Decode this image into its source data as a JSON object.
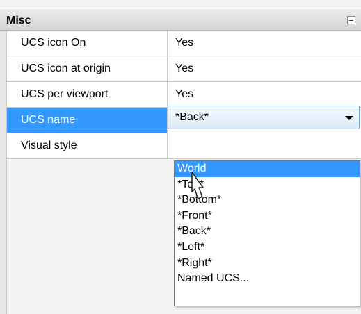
{
  "section": {
    "title": "Misc"
  },
  "rows": [
    {
      "name": "UCS icon On",
      "value": "Yes"
    },
    {
      "name": "UCS icon at origin",
      "value": "Yes"
    },
    {
      "name": "UCS per viewport",
      "value": "Yes"
    },
    {
      "name": "UCS name",
      "value": "*Back*"
    },
    {
      "name": "Visual style",
      "value": ""
    }
  ],
  "dropdown": {
    "selected": "*Back*",
    "options": [
      "World",
      "*Top*",
      "*Bottom*",
      "*Front*",
      "*Back*",
      "*Left*",
      "*Right*",
      "Named UCS..."
    ],
    "highlighted": "World"
  },
  "colors": {
    "selection": "#3399ff",
    "header": "#d9d9d9"
  },
  "icons": {
    "collapse": "collapse-icon",
    "dropdown_arrow": "chevron-down-icon",
    "cursor": "mouse-pointer-icon"
  }
}
